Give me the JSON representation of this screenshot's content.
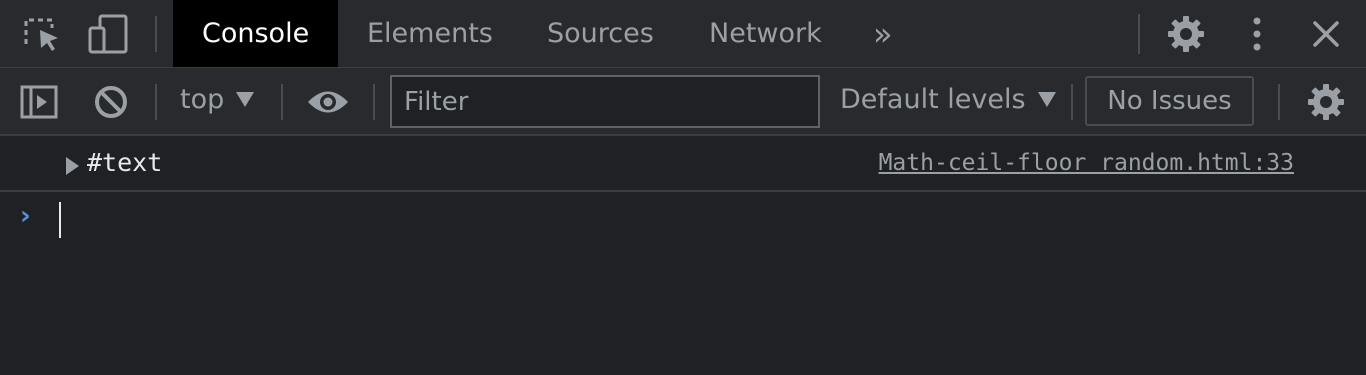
{
  "tabs": {
    "console": "Console",
    "elements": "Elements",
    "sources": "Sources",
    "network": "Network",
    "more": "»"
  },
  "toolbar": {
    "context": "top",
    "filter_placeholder": "Filter",
    "levels": "Default levels",
    "issues": "No Issues"
  },
  "console": {
    "message": "#text",
    "source": "Math-ceil-floor random.html:33",
    "prompt": "›"
  },
  "colors": {
    "background": "#202124",
    "toolbar": "#292a2d",
    "active_tab": "#000000",
    "prompt_accent": "#5b8fd9"
  },
  "icons": {
    "inspect": "inspect-element-icon",
    "device": "device-toolbar-icon",
    "settings": "gear-icon",
    "menu": "kebab-menu-icon",
    "close": "close-icon",
    "sidebar": "show-sidebar-icon",
    "clear": "clear-console-icon",
    "eye": "eye-icon"
  }
}
